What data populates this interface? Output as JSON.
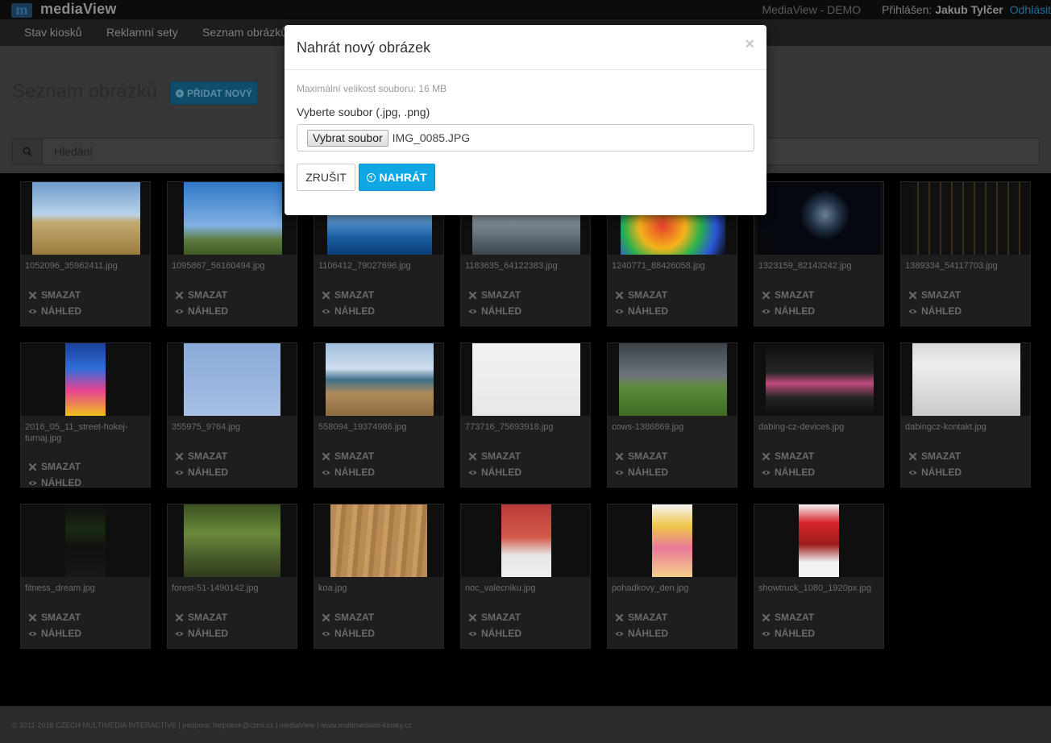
{
  "app": {
    "logo_letter": "m",
    "name": "mediaView",
    "instance": "MediaView - DEMO",
    "login_label": "Přihlášen:",
    "user": "Jakub Tylčer",
    "logout": "Odhlásit"
  },
  "nav": [
    "Stav kiosků",
    "Reklamní sety",
    "Seznam obrázků"
  ],
  "page": {
    "title": "Seznam obrázků",
    "add_label": "PŘIDAT NOVÝ",
    "search_placeholder": "Hledání"
  },
  "actions": {
    "delete": "SMAZAT",
    "preview": "NÁHLED"
  },
  "images": [
    "1052096_35962411.jpg",
    "1095867_56160494.jpg",
    "1106412_79027696.jpg",
    "1183635_64122383.jpg",
    "1240771_88426058.jpg",
    "1323159_82143242.jpg",
    "1389334_54117703.jpg",
    "2016_05_11_street-hokej-turnaj.jpg",
    "355975_9764.jpg",
    "558094_19374986.jpg",
    "773716_75693918.jpg",
    "cows-1386869.jpg",
    "dabing-cz-devices.jpg",
    "dabingcz-kontakt.jpg",
    "fitness_dream.jpg",
    "forest-51-1490142.jpg",
    "koa.jpg",
    "noc_valecniku.jpg",
    "pohadkovy_den.jpg",
    "showtruck_1080_1920px.jpg"
  ],
  "footer": "© 2011-2016 CZECH MULTIMEDIA INTERACTIVE | podpora: helpdesk@czmi.cz | mediaView | www.multimedialni-kiosky.cz",
  "modal": {
    "title": "Nahrát nový obrázek",
    "close": "×",
    "max_size": "Maximální velikost souboru: 16 MB",
    "file_label": "Vyberte soubor (.jpg, .png)",
    "file_button": "Vybrat soubor",
    "file_name": "IMG_0085.JPG",
    "cancel": "ZRUŠIT",
    "upload": "NAHRÁT"
  },
  "colors": {
    "primary": "#0fa7e4",
    "backdrop": "#000000",
    "card": "#1e1e1e"
  }
}
